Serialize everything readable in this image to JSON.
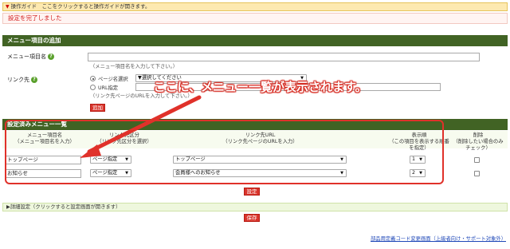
{
  "guide_bar": {
    "arrow": "▼",
    "text": "操作ガイド　ここをクリックすると操作ガイドが開きます。"
  },
  "message": {
    "text": "設定を完了しました"
  },
  "add_section": {
    "title": "メニュー項目の追加",
    "menu_name_label": "メニュー項目名",
    "menu_name_value": "",
    "menu_name_hint": "（メニュー項目名を入力して下さい。）",
    "link_label": "リンク先",
    "radio_page": "ページ名選択",
    "page_select": "▼選択してください",
    "radio_url": "URL指定",
    "url_value": "",
    "url_hint": "（リンク先ページのURLを入力して下さい。）",
    "add_button": "追加"
  },
  "callout": {
    "text": "ここに、メニュー一覧が表示されます。"
  },
  "list_section": {
    "title": "設定済みメニュー一覧",
    "headers": [
      {
        "label": "メニュー項目名",
        "sub": "（メニュー項目名を入力）"
      },
      {
        "label": "リンク先区分",
        "sub": "（リンク先区分を選択）"
      },
      {
        "label": "リンク先URL",
        "sub": "（リンク先ページのURLを入力）"
      },
      {
        "label": "表示順",
        "sub": "（この項目を表示する順番を指定）"
      },
      {
        "label": "削除",
        "sub": "（削除したい場合のみチェック）"
      }
    ],
    "rows": [
      {
        "name": "トップページ",
        "type": "ページ指定",
        "url": "トップページ",
        "order": "1",
        "delete": false
      },
      {
        "name": "お知らせ",
        "type": "ページ指定",
        "url": "会員様へのお知らせ",
        "order": "2",
        "delete": false
      }
    ],
    "set_button": "設定"
  },
  "detail_bar": {
    "arrow": "▶",
    "text": "詳細設定（クリックすると設定画面が開きます）"
  },
  "save_button": "保存",
  "footer_link": "部品用定義コード変更画面（上級者向け・サポート対象外）",
  "colors": {
    "accent": "#416324",
    "alert": "#d9342b",
    "callout": "#d62a20"
  }
}
